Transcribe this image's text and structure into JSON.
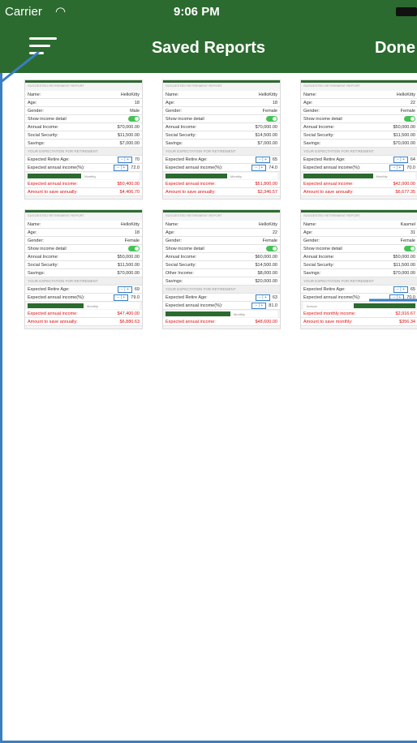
{
  "status": {
    "carrier": "Carrier",
    "time": "9:06 PM"
  },
  "navbar": {
    "title": "Saved Reports",
    "done_label": "Done"
  },
  "reports": [
    {
      "header": "SUGGESTED RETIREMENT REPORT",
      "rows": [
        {
          "l": "Name:",
          "v": "HelloKitty"
        },
        {
          "l": "Age:",
          "v": "18"
        },
        {
          "l": "Gender:",
          "v": "Male"
        },
        {
          "l": "Show income detail",
          "t": true
        },
        {
          "l": "Annual Income:",
          "v": "$70,000.00"
        },
        {
          "l": "Social Security:",
          "v": "$11,500.00"
        },
        {
          "l": "Savings:",
          "v": "$7,000.00"
        },
        {
          "s": "YOUR EXPECTATION FOR RETIREMENT"
        },
        {
          "l": "Expected Retire Age:",
          "v": "70",
          "st": true
        },
        {
          "l": "Expected annual income(%):",
          "v": "72.0",
          "st": true
        },
        {
          "b": 0.48,
          "bl": "Monthly"
        },
        {
          "l": "Expected annual income:",
          "v": "$50,400.00",
          "r": true
        },
        {
          "l": "Amount to save annually:",
          "v": "$4,406.70",
          "r": true
        }
      ]
    },
    {
      "header": "SUGGESTED RETIREMENT REPORT",
      "rows": [
        {
          "l": "Name:",
          "v": "HelloKitty"
        },
        {
          "l": "Age:",
          "v": "18"
        },
        {
          "l": "Gender:",
          "v": "Female"
        },
        {
          "l": "Show income detail",
          "t": true
        },
        {
          "l": "Annual Income:",
          "v": "$70,000.00"
        },
        {
          "l": "Social Security:",
          "v": "$14,500.00"
        },
        {
          "l": "Savings:",
          "v": "$7,000.00"
        },
        {
          "s": "YOUR EXPECTATION FOR RETIREMENT"
        },
        {
          "l": "Expected Retire Age:",
          "v": "65",
          "st": true
        },
        {
          "l": "Expected annual income(%):",
          "v": "74.0",
          "st": true
        },
        {
          "b": 0.55,
          "bl": "Monthly"
        },
        {
          "l": "Expected annual income:",
          "v": "$51,800.00",
          "r": true
        },
        {
          "l": "Amount to save annually:",
          "v": "$2,346.57",
          "r": true
        }
      ]
    },
    {
      "header": "SUGGESTED RETIREMENT REPORT",
      "rows": [
        {
          "l": "Name:",
          "v": "HelloKitty"
        },
        {
          "l": "Age:",
          "v": "22"
        },
        {
          "l": "Gender:",
          "v": "Female"
        },
        {
          "l": "Show income detail",
          "t": true
        },
        {
          "l": "Annual Income:",
          "v": "$50,000.00"
        },
        {
          "l": "Social Security:",
          "v": "$11,500.00"
        },
        {
          "l": "Savings:",
          "v": "$70,000.00"
        },
        {
          "s": "YOUR EXPECTATION FOR RETIREMENT"
        },
        {
          "l": "Expected Retire Age:",
          "v": "64",
          "st": true
        },
        {
          "l": "Expected annual income(%):",
          "v": "70.0",
          "st": true
        },
        {
          "b": 0.62,
          "bl": "Monthly"
        },
        {
          "l": "Expected annual income:",
          "v": "$42,000.00",
          "r": true
        },
        {
          "l": "Amount to save annually:",
          "v": "$6,677.35",
          "r": true
        }
      ]
    },
    {
      "header": "SUGGESTED RETIREMENT REPORT",
      "rows": [
        {
          "l": "Name:",
          "v": "HelloKitty"
        },
        {
          "l": "Age:",
          "v": "18"
        },
        {
          "l": "Gender:",
          "v": "Female"
        },
        {
          "l": "Show income detail",
          "t": true
        },
        {
          "l": "Annual Income:",
          "v": "$50,000.00"
        },
        {
          "l": "Social Security:",
          "v": "$11,500.00"
        },
        {
          "l": "Savings:",
          "v": "$70,000.00"
        },
        {
          "s": "YOUR EXPECTATION FOR RETIREMENT"
        },
        {
          "l": "Expected Retire Age:",
          "v": "69",
          "st": true
        },
        {
          "l": "Expected annual income(%):",
          "v": "79.0",
          "st": true
        },
        {
          "b": 0.5,
          "bl": "Monthly"
        },
        {
          "l": "Expected annual income:",
          "v": "$47,400.00",
          "r": true
        },
        {
          "l": "Amount to save annually:",
          "v": "$6,880.63",
          "r": true
        }
      ]
    },
    {
      "header": "SUGGESTED RETIREMENT REPORT",
      "rows": [
        {
          "l": "Name:",
          "v": "HelloKitty"
        },
        {
          "l": "Age:",
          "v": "22"
        },
        {
          "l": "Gender:",
          "v": "Female"
        },
        {
          "l": "Show income detail",
          "t": true
        },
        {
          "l": "Annual Income:",
          "v": "$60,000.00"
        },
        {
          "l": "Social Security:",
          "v": "$14,500.00"
        },
        {
          "l": "Other Income:",
          "v": "$8,000.00"
        },
        {
          "l": "Savings:",
          "v": "$20,000.00"
        },
        {
          "s": "YOUR EXPECTATION FOR RETIREMENT"
        },
        {
          "l": "Expected Retire Age:",
          "v": "63",
          "st": true
        },
        {
          "l": "Expected annual income(%):",
          "v": "81.0",
          "st": true
        },
        {
          "b": 0.58,
          "bl": "Monthly"
        },
        {
          "l": "Expected annual income:",
          "v": "$48,600.00",
          "r": true
        }
      ]
    },
    {
      "header": "SUGGESTED RETIREMENT REPORT",
      "rows": [
        {
          "l": "Name:",
          "v": "Kasmel"
        },
        {
          "l": "Age:",
          "v": "31"
        },
        {
          "l": "Gender:",
          "v": "Female"
        },
        {
          "l": "Show income detail",
          "t": true
        },
        {
          "l": "Annual Income:",
          "v": "$50,000.00"
        },
        {
          "l": "Social Security:",
          "v": "$11,500.00"
        },
        {
          "l": "Savings:",
          "v": "$70,000.00"
        },
        {
          "s": "YOUR EXPECTATION FOR RETIREMENT"
        },
        {
          "l": "Expected Retire Age:",
          "v": "65",
          "st": true
        },
        {
          "l": "Expected annual income(%):",
          "v": "70.0",
          "st": true
        },
        {
          "b": 0.55,
          "bl": "Annual",
          "left": true
        },
        {
          "l": "Expected monthly income:",
          "v": "$2,916.67",
          "r": true
        },
        {
          "l": "Amount to save monthly:",
          "v": "$356.34",
          "r": true
        }
      ]
    }
  ]
}
